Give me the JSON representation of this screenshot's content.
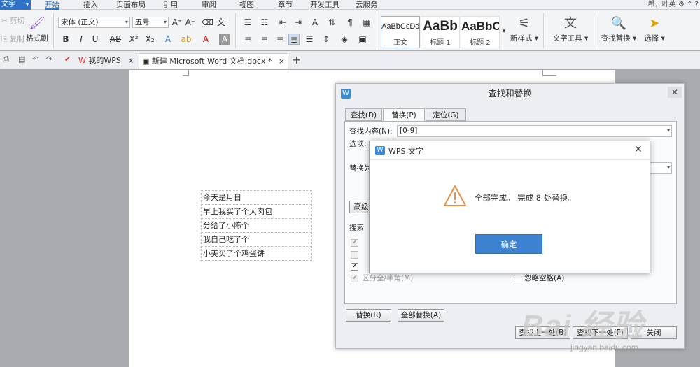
{
  "app": {
    "menu_label": "文字",
    "user_text": "希，叶英",
    "tabs": [
      "开始",
      "插入",
      "页面布局",
      "引用",
      "审阅",
      "视图",
      "章节",
      "开发工具",
      "云服务"
    ],
    "accent": "#2d73c8"
  },
  "ribbon": {
    "cut": "剪切",
    "copy": "复制",
    "format_painter": "格式刷",
    "font_name": "宋体 (正文)",
    "font_size": "五号",
    "styles": [
      {
        "preview": "AaBbCcDd",
        "label": "正文"
      },
      {
        "preview": "AaBb",
        "label": "标题 1"
      },
      {
        "preview": "AaBbC",
        "label": "标题 2"
      }
    ],
    "new_style": "新样式",
    "text_tools": "文字工具",
    "find_replace": "查找替换",
    "select": "选择"
  },
  "doc_tabs": [
    {
      "label": "我的WPS"
    },
    {
      "label": "新建 Microsoft Word 文档.docx *"
    }
  ],
  "document": {
    "rows": [
      "今天是月日",
      "早上我买了个大肉包",
      "分给了小陈个",
      "我自己吃了个",
      "小美买了个鸡蛋饼"
    ]
  },
  "find_replace": {
    "title": "查找和替换",
    "tabs": [
      "查找(D)",
      "替换(P)",
      "定位(G)"
    ],
    "find_label": "查找内容(N):",
    "find_value": "[0-9]",
    "options_label": "选项:",
    "replace_label": "替换为",
    "advanced_button": "高级",
    "search_label": "搜索",
    "opt_fullhalf": "区分全/半角(M)",
    "opt_ignore_space": "忽略空格(A)",
    "replace_button": "替换(R)",
    "replace_all_button": "全部替换(A)",
    "find_prev_button": "查找上一处(B)",
    "find_next_button": "查找下一处(F)",
    "close_button": "关闭"
  },
  "alert": {
    "title": "WPS 文字",
    "message": "全部完成。 完成 8 处替换。",
    "ok": "确定"
  },
  "watermark": {
    "brand": "Bai 经验",
    "url": "jingyan.baidu.com"
  }
}
